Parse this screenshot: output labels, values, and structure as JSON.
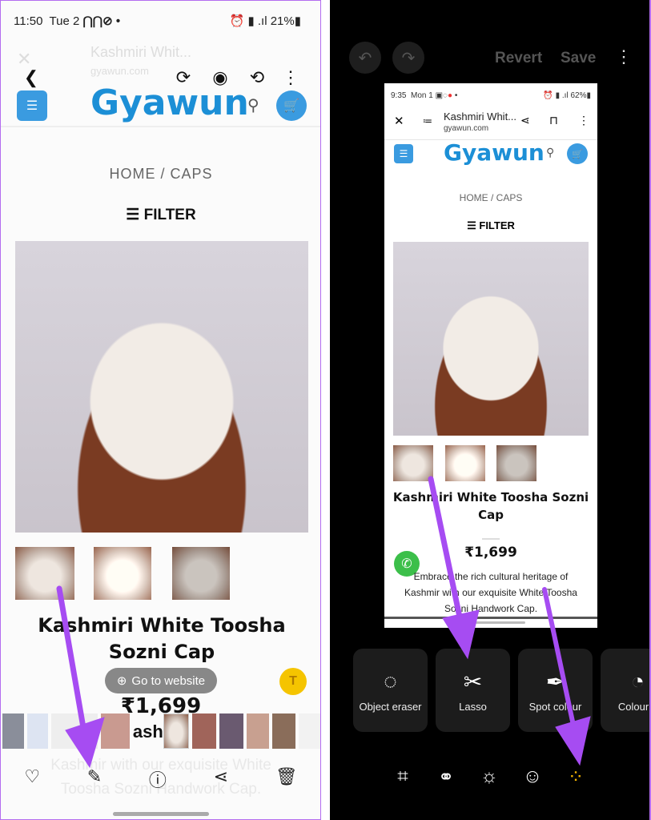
{
  "left": {
    "status": {
      "time": "11:50",
      "date": "Tue 2",
      "battery": "21%"
    },
    "ghost_header": {
      "title": "Kashmiri Whit...",
      "domain": "gyawun.com"
    },
    "viewer_icons": [
      "back-icon",
      "motion-photo-icon",
      "eye-icon",
      "rotate-icon",
      "more-icon"
    ],
    "logo": "Gyawun",
    "breadcrumb": "HOME / CAPS",
    "filter": "FILTER",
    "product_title": "Kashmiri White Toosha Sozni Cap",
    "go_to_website": "Go to website",
    "price": "₹1,699",
    "strip_text": "ash",
    "desc_ghost": "Kashmir with our exquisite White Toosha Sozni Handwork Cap.",
    "bottom_icons": [
      "heart-icon",
      "pencil-icon",
      "info-icon",
      "share-icon",
      "trash-icon"
    ]
  },
  "right": {
    "toolbar": {
      "revert": "Revert",
      "save": "Save"
    },
    "preview": {
      "status": {
        "time": "9:35",
        "date": "Mon 1",
        "battery": "62%"
      },
      "header": {
        "title": "Kashmiri Whit...",
        "domain": "gyawun.com"
      },
      "logo": "Gyawun",
      "breadcrumb": "HOME / CAPS",
      "filter": "FILTER",
      "product_title": "Kashmiri White Toosha Sozni Cap",
      "price": "₹1,699",
      "description": "Embrace the rich cultural heritage of Kashmir with our exquisite White Toosha Sozni Handwork Cap."
    },
    "tools": [
      {
        "label": "Object eraser",
        "icon": "object-eraser-icon"
      },
      {
        "label": "Lasso",
        "icon": "lasso-icon"
      },
      {
        "label": "Spot colour",
        "icon": "spot-colour-icon"
      },
      {
        "label": "Colour n",
        "icon": "palette-icon"
      }
    ],
    "bottom_icons": [
      "crop-rotate-icon",
      "filter-icon",
      "brightness-icon",
      "sticker-icon",
      "more-tools-icon"
    ]
  },
  "colors": {
    "arrow": "#a64cf2",
    "accent": "#f5b400",
    "brand": "#1c8fd6"
  }
}
